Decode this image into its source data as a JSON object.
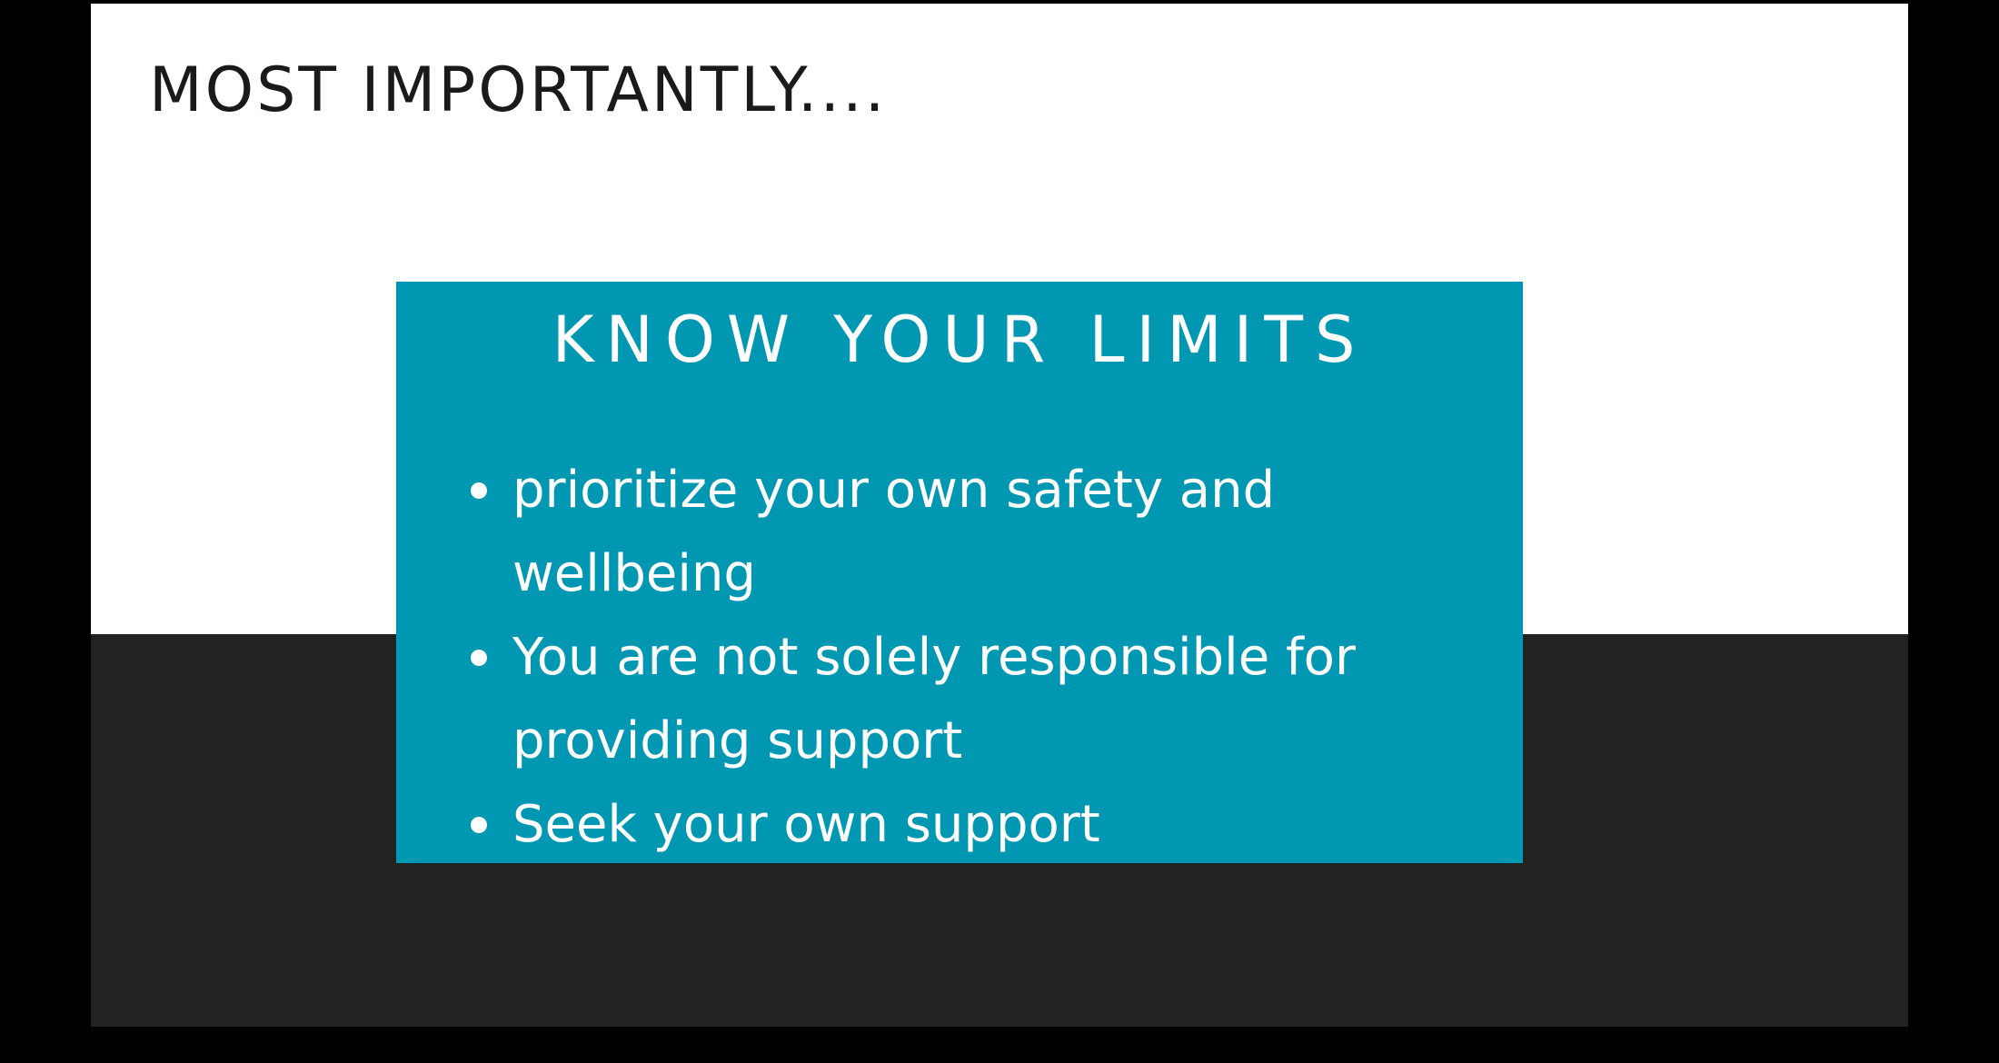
{
  "slide": {
    "title": "MOST IMPORTANTLY....",
    "callout": {
      "heading": "KNOW YOUR LIMITS",
      "items": [
        "prioritize your own safety and wellbeing",
        "You are not solely responsible for providing support",
        "Seek your own support"
      ]
    }
  },
  "colors": {
    "page_background": "#000000",
    "slide_top": "#ffffff",
    "slide_bottom": "#222222",
    "callout_background": "#0097b2",
    "callout_text": "#ffffff",
    "title_text": "#1a1a1a"
  }
}
